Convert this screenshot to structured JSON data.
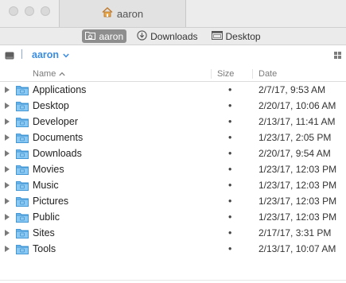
{
  "window": {
    "tab_title": "aaron"
  },
  "favorites": [
    {
      "label": "aaron",
      "icon": "home-folder-icon",
      "active": true
    },
    {
      "label": "Downloads",
      "icon": "download-icon",
      "active": false
    },
    {
      "label": "Desktop",
      "icon": "desktop-icon",
      "active": false
    }
  ],
  "toolbar": {
    "location": "aaron"
  },
  "columns": {
    "name": "Name",
    "size": "Size",
    "date": "Date"
  },
  "files": [
    {
      "name": "Applications",
      "size": "•",
      "date": "2/7/17, 9:53 AM",
      "icon": "applications-folder-icon"
    },
    {
      "name": "Desktop",
      "size": "•",
      "date": "2/20/17, 10:06 AM",
      "icon": "desktop-folder-icon"
    },
    {
      "name": "Developer",
      "size": "•",
      "date": "2/13/17, 11:41 AM",
      "icon": "developer-folder-icon"
    },
    {
      "name": "Documents",
      "size": "•",
      "date": "1/23/17, 2:05 PM",
      "icon": "documents-folder-icon"
    },
    {
      "name": "Downloads",
      "size": "•",
      "date": "2/20/17, 9:54 AM",
      "icon": "downloads-folder-icon"
    },
    {
      "name": "Movies",
      "size": "•",
      "date": "1/23/17, 12:03 PM",
      "icon": "movies-folder-icon"
    },
    {
      "name": "Music",
      "size": "•",
      "date": "1/23/17, 12:03 PM",
      "icon": "music-folder-icon"
    },
    {
      "name": "Pictures",
      "size": "•",
      "date": "1/23/17, 12:03 PM",
      "icon": "pictures-folder-icon"
    },
    {
      "name": "Public",
      "size": "•",
      "date": "1/23/17, 12:03 PM",
      "icon": "public-folder-icon"
    },
    {
      "name": "Sites",
      "size": "•",
      "date": "2/17/17, 3:31 PM",
      "icon": "sites-folder-icon"
    },
    {
      "name": "Tools",
      "size": "•",
      "date": "2/13/17, 10:07 AM",
      "icon": "folder-icon"
    }
  ],
  "colors": {
    "accent": "#3b8de0",
    "folder": "#5aaee8"
  }
}
